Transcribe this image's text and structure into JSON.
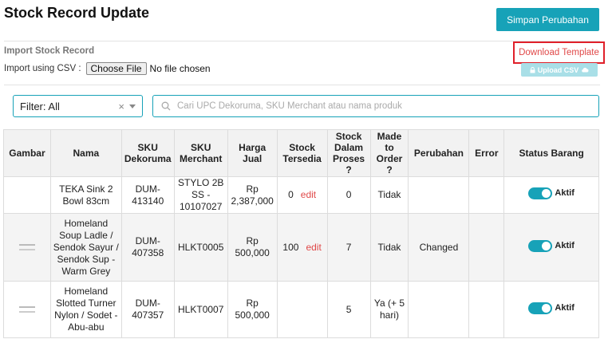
{
  "page": {
    "title": "Stock Record Update",
    "save_button": "Simpan Perubahan"
  },
  "import": {
    "title": "Import Stock Record",
    "csv_label": "Import using CSV :",
    "choose_file": "Choose File",
    "no_file": "No file chosen",
    "download_template": "Download Template",
    "upload_csv": "Upload CSV"
  },
  "filter": {
    "value": "Filter: All",
    "clear": "×"
  },
  "search": {
    "placeholder": "Cari UPC Dekoruma, SKU Merchant atau nama produk"
  },
  "table": {
    "headers": {
      "gambar": "Gambar",
      "nama": "Nama",
      "sku_dekoruma": "SKU Dekoruma",
      "sku_merchant": "SKU Merchant",
      "harga_jual": "Harga Jual",
      "stock_tersedia": "Stock Tersedia",
      "stock_dalam_proses": "Stock Dalam Proses ?",
      "made_to_order": "Made to Order ?",
      "perubahan": "Perubahan",
      "error": "Error",
      "status_barang": "Status Barang"
    },
    "edit_label": "edit",
    "rows": [
      {
        "nama": "TEKA Sink 2 Bowl 83cm",
        "sku_dekoruma": "DUM-413140",
        "sku_merchant": "STYLO 2B SS - 10107027",
        "harga_jual": "Rp 2,387,000",
        "stock_tersedia": "0",
        "stock_dalam_proses": "0",
        "made_to_order": "Tidak",
        "perubahan": "",
        "error": "",
        "status": "Aktif",
        "has_image": false
      },
      {
        "nama": "Homeland Soup Ladle / Sendok Sayur / Sendok Sup - Warm Grey",
        "sku_dekoruma": "DUM-407358",
        "sku_merchant": "HLKT0005",
        "harga_jual": "Rp 500,000",
        "stock_tersedia": "100",
        "stock_dalam_proses": "7",
        "made_to_order": "Tidak",
        "perubahan": "Changed",
        "error": "",
        "status": "Aktif",
        "has_image": true
      },
      {
        "nama": "Homeland Slotted Turner Nylon / Sodet - Abu-abu",
        "sku_dekoruma": "DUM-407357",
        "sku_merchant": "HLKT0007",
        "harga_jual": "Rp 500,000",
        "stock_tersedia": "",
        "stock_dalam_proses": "5",
        "made_to_order": "Ya (+ 5 hari)",
        "perubahan": "",
        "error": "",
        "status": "Aktif",
        "has_image": true
      }
    ]
  },
  "colors": {
    "accent": "#17a2b8",
    "edit_link": "#e04848",
    "highlight_border": "#e0202a"
  }
}
